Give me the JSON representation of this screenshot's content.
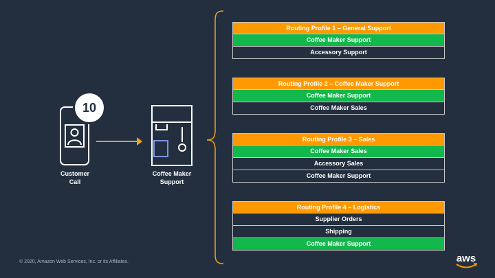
{
  "customer": {
    "badge": "10",
    "label": "Customer\nCall"
  },
  "queue": {
    "label": "Coffee Maker\nSupport"
  },
  "routing_profiles": [
    {
      "title": "Routing Profile 1 – General Support",
      "queues": [
        {
          "name": "Coffee Maker Support",
          "highlight": true
        },
        {
          "name": "Accessory Support",
          "highlight": false
        }
      ]
    },
    {
      "title": "Routing Profile 2 – Coffee Maker Support",
      "queues": [
        {
          "name": "Coffee Maker Support",
          "highlight": true
        },
        {
          "name": "Coffee Maker Sales",
          "highlight": false
        }
      ]
    },
    {
      "title": "Routing Profile 3 – Sales",
      "queues": [
        {
          "name": "Coffee Maker Sales",
          "highlight": true
        },
        {
          "name": "Accessory Sales",
          "highlight": false
        },
        {
          "name": "Coffee Maker Support",
          "highlight": false
        }
      ]
    },
    {
      "title": "Routing Profile 4 – Logistics",
      "queues": [
        {
          "name": "Supplier Orders",
          "highlight": false
        },
        {
          "name": "Shipping",
          "highlight": false
        },
        {
          "name": "Coffee Maker Support",
          "highlight": true
        }
      ]
    }
  ],
  "footer": {
    "copyright": "© 2020, Amazon Web Services, Inc. or its Affiliates.",
    "logo_text": "aws"
  },
  "colors": {
    "background": "#232f3e",
    "header": "#ff9900",
    "highlight": "#12b84b",
    "arrow": "#f6a01a",
    "brace": "#f6a01a"
  }
}
